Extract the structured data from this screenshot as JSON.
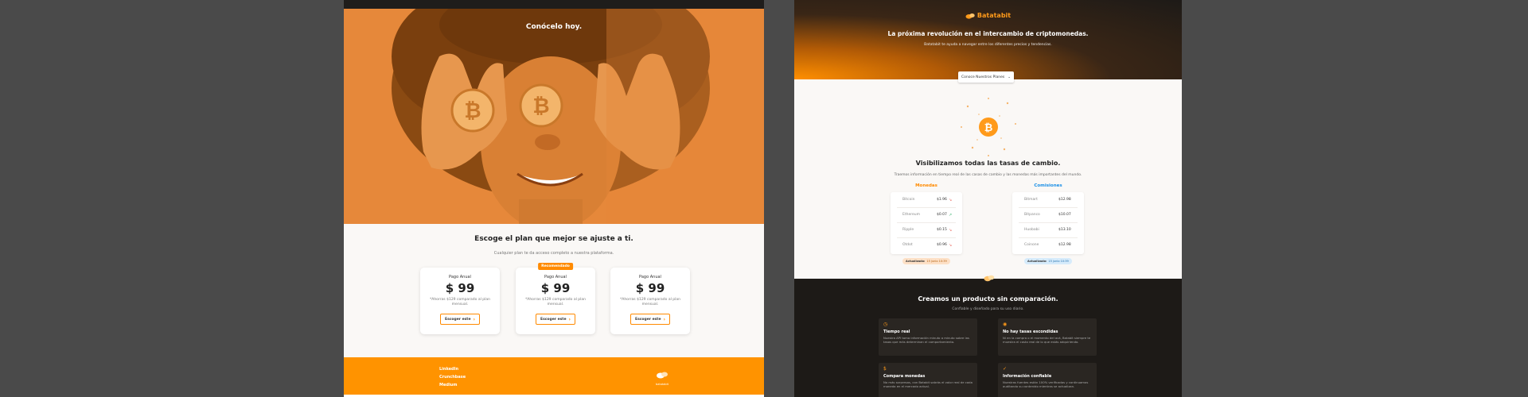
{
  "left": {
    "hero": {
      "title": "Conócelo hoy."
    },
    "plans": {
      "title": "Escoge el plan que mejor se ajuste a ti.",
      "subtitle": "Cualquier plan te da acceso completo a nuestra plataforma.",
      "cards": [
        {
          "name": "Pago Anual",
          "price": "$ 99",
          "note": "*Ahorras $129 comparado al plan mensual.",
          "button": "Escoger este",
          "badge": ""
        },
        {
          "name": "Pago Anual",
          "price": "$ 99",
          "note": "*Ahorras $129 comparado al plan mensual.",
          "button": "Escoger este",
          "badge": "Recomendado"
        },
        {
          "name": "Pago Anual",
          "price": "$ 99",
          "note": "*Ahorras $129 comparado al plan mensual.",
          "button": "Escoger este",
          "badge": ""
        }
      ]
    },
    "footer": {
      "links": [
        "LinkedIn",
        "Crunchbase",
        "Medium"
      ],
      "logo_text": "batatabit"
    }
  },
  "right": {
    "brand": "Batatabit",
    "hero": {
      "title": "La próxima revolución en el intercambio de criptomonedas.",
      "subtitle": "Batatabit te ayuda a navegar entre los diferentes precios y tendencias.",
      "plans_button": "Conoce Nuestros Planes"
    },
    "rates": {
      "title": "Visibilizamos todas las tasas de cambio.",
      "subtitle": "Traemos información en tiempo real de las casas de cambio y las monedas más importantes del mundo.",
      "coins_title": "Monedas",
      "fees_title": "Comisiones",
      "coins": [
        {
          "name": "Bitcoin",
          "value": "$1.96",
          "trend": "down"
        },
        {
          "name": "Ethereum",
          "value": "$0.07",
          "trend": "up"
        },
        {
          "name": "Ripple",
          "value": "$0.15",
          "trend": "down"
        },
        {
          "name": "Otdot",
          "value": "$0.96",
          "trend": "down"
        }
      ],
      "fees": [
        {
          "name": "Bitmart",
          "value": "$12.98"
        },
        {
          "name": "Bitpanco",
          "value": "$10.07"
        },
        {
          "name": "Huobabi",
          "value": "$13.10"
        },
        {
          "name": "Coinone",
          "value": "$12.98"
        }
      ],
      "updated_label": "Actualizado:",
      "updated_time": "15 junio 10:39"
    },
    "features": {
      "title": "Creamos un producto sin comparación.",
      "subtitle": "Confiable y diseñado para su uso diario.",
      "cards": [
        {
          "icon": "clock-icon",
          "title": "Tiempo real",
          "text": "Nuestra API toma información minuto a minuto sobre las tasas que más determinan el comportamiento."
        },
        {
          "icon": "eye-icon",
          "title": "No hay tasas escondidas",
          "text": "Ni en la compra o el momento del acá, Batabit siempre te muestra el costo real de lo que estás adquiriendo."
        },
        {
          "icon": "dollar-icon",
          "title": "Compara monedas",
          "text": "No más sorpresas, con Batabit sabrás el valor real de cada moneda en el mercado actual."
        },
        {
          "icon": "check-icon",
          "title": "Información confiable",
          "text": "Nuestras fuentes están 100% verificadas y continuamos auditando su contenido mientras se actualizan."
        }
      ]
    }
  }
}
